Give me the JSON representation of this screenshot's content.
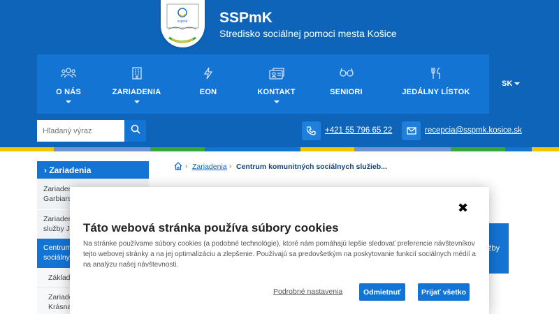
{
  "header": {
    "site_title": "SSPmK",
    "site_subtitle": "Stredisko sociálnej pomoci mesta Košice",
    "logo_text": "sspmk"
  },
  "nav": {
    "items": [
      {
        "label": "O NÁS",
        "icon": "people-icon",
        "has_dropdown": true
      },
      {
        "label": "ZARIADENIA",
        "icon": "building-icon",
        "has_dropdown": true
      },
      {
        "label": "EON",
        "icon": "lightning-icon",
        "has_dropdown": false
      },
      {
        "label": "KONTAKT",
        "icon": "contact-card-icon",
        "has_dropdown": true
      },
      {
        "label": "SENIORI",
        "icon": "glasses-icon",
        "has_dropdown": false
      },
      {
        "label": "JEDÁLNY LÍSTOK",
        "icon": "cutlery-icon",
        "has_dropdown": false
      }
    ],
    "language": "SK"
  },
  "toolbar": {
    "search_placeholder": "Hľadaný výraz",
    "phone": "+421 55 796 65 22",
    "email": "recepcia@sspmk.kosice.sk"
  },
  "stripe_colors": [
    "#f2c500",
    "#6c96d4",
    "#3aa63a",
    "#1474d4",
    "#f2c500",
    "#6c96d4",
    "#3aa63a",
    "#1474d4",
    "#f2c500"
  ],
  "sidebar": {
    "heading": "Zariadenia",
    "items": [
      {
        "line1": "Zariader",
        "line2": "Garbiars"
      },
      {
        "line1": "Zariader",
        "line2": "služby Jo"
      },
      {
        "line1": "Centrum",
        "line2": "sociálny"
      }
    ],
    "subitems": [
      {
        "line1": "Základ"
      },
      {
        "line1": "Zariade",
        "line2": "Krásna"
      }
    ]
  },
  "breadcrumb": {
    "link": "Zariadenia",
    "current": "Centrum komunitných sociálnych služieb..."
  },
  "blue_card_text": "žby",
  "cookie_modal": {
    "title": "Táto webová stránka používa súbory cookies",
    "text": "Na stránke používame súbory cookies (a podobné technológie), ktoré nám pomáhajú lepšie sledovať preferencie návštevníkov tejto webovej stránky a na jej optimalizáciu a zlepšenie. Používajú sa predovšetkým na poskytovanie funkcií sociálnych médií a na analýzu našej návštevnosti.",
    "settings_link": "Podrobné nastavenia",
    "reject_label": "Odmietnuť",
    "accept_label": "Prijať všetko",
    "close_glyph": "✖"
  },
  "colors": {
    "header_blue": "#0d64b8",
    "nav_blue": "#1474d4"
  }
}
